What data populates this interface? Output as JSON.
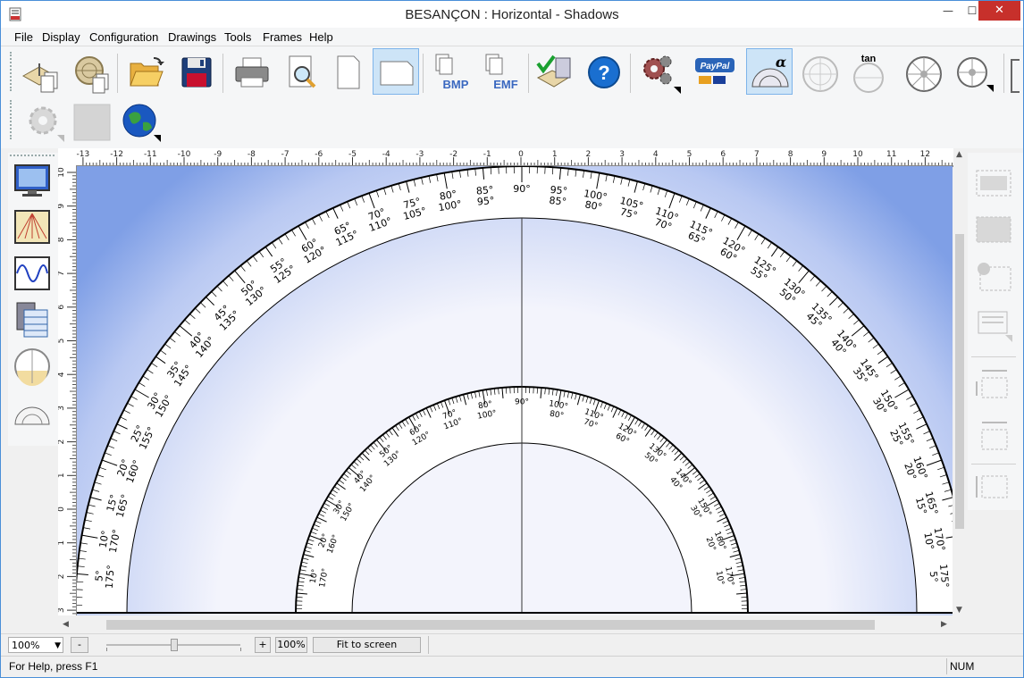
{
  "window": {
    "title": "BESANÇON : Horizontal - Shadows",
    "minimize_glyph": "—",
    "maximize_glyph": "☐",
    "close_glyph": "✕"
  },
  "menu": [
    "File",
    "Display",
    "Configuration",
    "Drawings",
    "Tools",
    "Frames",
    "Help"
  ],
  "toolbar": {
    "row1": [
      {
        "name": "new-sundial-icon"
      },
      {
        "name": "new-astrolabe-icon"
      },
      {
        "name": "open-folder-icon"
      },
      {
        "name": "save-disk-icon"
      },
      {
        "name": "printer-icon"
      },
      {
        "name": "print-preview-icon"
      },
      {
        "name": "page-portrait-icon"
      },
      {
        "name": "page-landscape-icon",
        "active": true
      },
      {
        "name": "export-bmp-icon",
        "label": "BMP"
      },
      {
        "name": "export-emf-icon",
        "label": "EMF"
      },
      {
        "name": "calculator-check-icon"
      },
      {
        "name": "help-icon",
        "label": "?"
      },
      {
        "name": "settings-gears-icon"
      },
      {
        "name": "paypal-donate-icon",
        "label": "PayPal"
      },
      {
        "name": "alpha-protractor-icon",
        "label": "α",
        "active": true
      },
      {
        "name": "circle-grid-icon"
      },
      {
        "name": "tangent-scale-icon",
        "label": "tan"
      },
      {
        "name": "wheel-scale-icon"
      },
      {
        "name": "wheel-scale-menu-icon"
      }
    ],
    "row2": [
      {
        "name": "puzzle-gear-icon"
      },
      {
        "name": "blank-tile-icon"
      },
      {
        "name": "globe-icon"
      }
    ]
  },
  "left_toolbar": [
    "monitor-grid-icon",
    "sundial-lines-icon",
    "sine-wave-icon",
    "calculator-table-icon",
    "dial-drum-icon",
    "protractor-icon"
  ],
  "right_toolbar": [
    "text-label-icon",
    "image-block-icon",
    "shape-insert-icon",
    "list-insert-icon",
    "width-arrows-icon",
    "height-width-icon",
    "height-arrows-icon"
  ],
  "rulers": {
    "horizontal": [
      -13,
      -12,
      -11,
      -10,
      -9,
      -8,
      -7,
      -6,
      -5,
      -4,
      -3,
      -2,
      -1,
      0,
      1,
      2,
      3,
      4,
      5,
      6,
      7,
      8,
      9,
      10,
      11,
      12
    ],
    "vertical": [
      10,
      9,
      8,
      7,
      6,
      5,
      4,
      3,
      2,
      1,
      0,
      1,
      2,
      3
    ]
  },
  "drawing": {
    "outer_labels": [
      {
        "a": 5,
        "l1": "5°",
        "l2": "175°"
      },
      {
        "a": 10,
        "l1": "10°",
        "l2": "170°"
      },
      {
        "a": 15,
        "l1": "15°",
        "l2": "165°"
      },
      {
        "a": 20,
        "l1": "20°",
        "l2": "160°"
      },
      {
        "a": 25,
        "l1": "25°",
        "l2": "155°"
      },
      {
        "a": 30,
        "l1": "30°",
        "l2": "150°"
      },
      {
        "a": 35,
        "l1": "35°",
        "l2": "145°"
      },
      {
        "a": 40,
        "l1": "40°",
        "l2": "140°"
      },
      {
        "a": 45,
        "l1": "45°",
        "l2": "135°"
      },
      {
        "a": 50,
        "l1": "50°",
        "l2": "130°"
      },
      {
        "a": 55,
        "l1": "55°",
        "l2": "125°"
      },
      {
        "a": 60,
        "l1": "60°",
        "l2": "120°"
      },
      {
        "a": 65,
        "l1": "65°",
        "l2": "115°"
      },
      {
        "a": 70,
        "l1": "70°",
        "l2": "110°"
      },
      {
        "a": 75,
        "l1": "75°",
        "l2": "105°"
      },
      {
        "a": 80,
        "l1": "80°",
        "l2": "100°"
      },
      {
        "a": 85,
        "l1": "85°",
        "l2": "95°"
      },
      {
        "a": 90,
        "l1": "90°",
        "l2": ""
      },
      {
        "a": 95,
        "l1": "95°",
        "l2": "85°"
      },
      {
        "a": 100,
        "l1": "100°",
        "l2": "80°"
      },
      {
        "a": 105,
        "l1": "105°",
        "l2": "75°"
      },
      {
        "a": 110,
        "l1": "110°",
        "l2": "70°"
      },
      {
        "a": 115,
        "l1": "115°",
        "l2": "65°"
      },
      {
        "a": 120,
        "l1": "120°",
        "l2": "60°"
      },
      {
        "a": 125,
        "l1": "125°",
        "l2": "55°"
      },
      {
        "a": 130,
        "l1": "130°",
        "l2": "50°"
      },
      {
        "a": 135,
        "l1": "135°",
        "l2": "45°"
      },
      {
        "a": 140,
        "l1": "140°",
        "l2": "40°"
      },
      {
        "a": 145,
        "l1": "145°",
        "l2": "35°"
      },
      {
        "a": 150,
        "l1": "150°",
        "l2": "30°"
      },
      {
        "a": 155,
        "l1": "155°",
        "l2": "25°"
      },
      {
        "a": 160,
        "l1": "160°",
        "l2": "20°"
      },
      {
        "a": 165,
        "l1": "165°",
        "l2": "15°"
      },
      {
        "a": 170,
        "l1": "170°",
        "l2": "10°"
      },
      {
        "a": 175,
        "l1": "175°",
        "l2": "5°"
      }
    ],
    "inner_labels": [
      {
        "a": 10,
        "l1": "10°",
        "l2": "170°"
      },
      {
        "a": 20,
        "l1": "20°",
        "l2": "160°"
      },
      {
        "a": 30,
        "l1": "30°",
        "l2": "150°"
      },
      {
        "a": 40,
        "l1": "40°",
        "l2": "140°"
      },
      {
        "a": 50,
        "l1": "50°",
        "l2": "130°"
      },
      {
        "a": 60,
        "l1": "60°",
        "l2": "120°"
      },
      {
        "a": 70,
        "l1": "70°",
        "l2": "110°"
      },
      {
        "a": 80,
        "l1": "80°",
        "l2": "100°"
      },
      {
        "a": 90,
        "l1": "90°",
        "l2": ""
      },
      {
        "a": 100,
        "l1": "100°",
        "l2": "80°"
      },
      {
        "a": 110,
        "l1": "110°",
        "l2": "70°"
      },
      {
        "a": 120,
        "l1": "120°",
        "l2": "60°"
      },
      {
        "a": 130,
        "l1": "130°",
        "l2": "50°"
      },
      {
        "a": 140,
        "l1": "140°",
        "l2": "40°"
      },
      {
        "a": 150,
        "l1": "150°",
        "l2": "30°"
      },
      {
        "a": 160,
        "l1": "160°",
        "l2": "20°"
      },
      {
        "a": 170,
        "l1": "170°",
        "l2": "10°"
      }
    ],
    "background_colors": {
      "edge": "#7f9fe6",
      "light": "#f3f4fc"
    }
  },
  "zoom": {
    "value": "100%",
    "minus_label": "-",
    "plus_label": "+",
    "reset_label": "100%",
    "fit_label": "Fit to screen",
    "level": 0.5
  },
  "status": {
    "help": "For Help, press F1",
    "num": "NUM"
  }
}
